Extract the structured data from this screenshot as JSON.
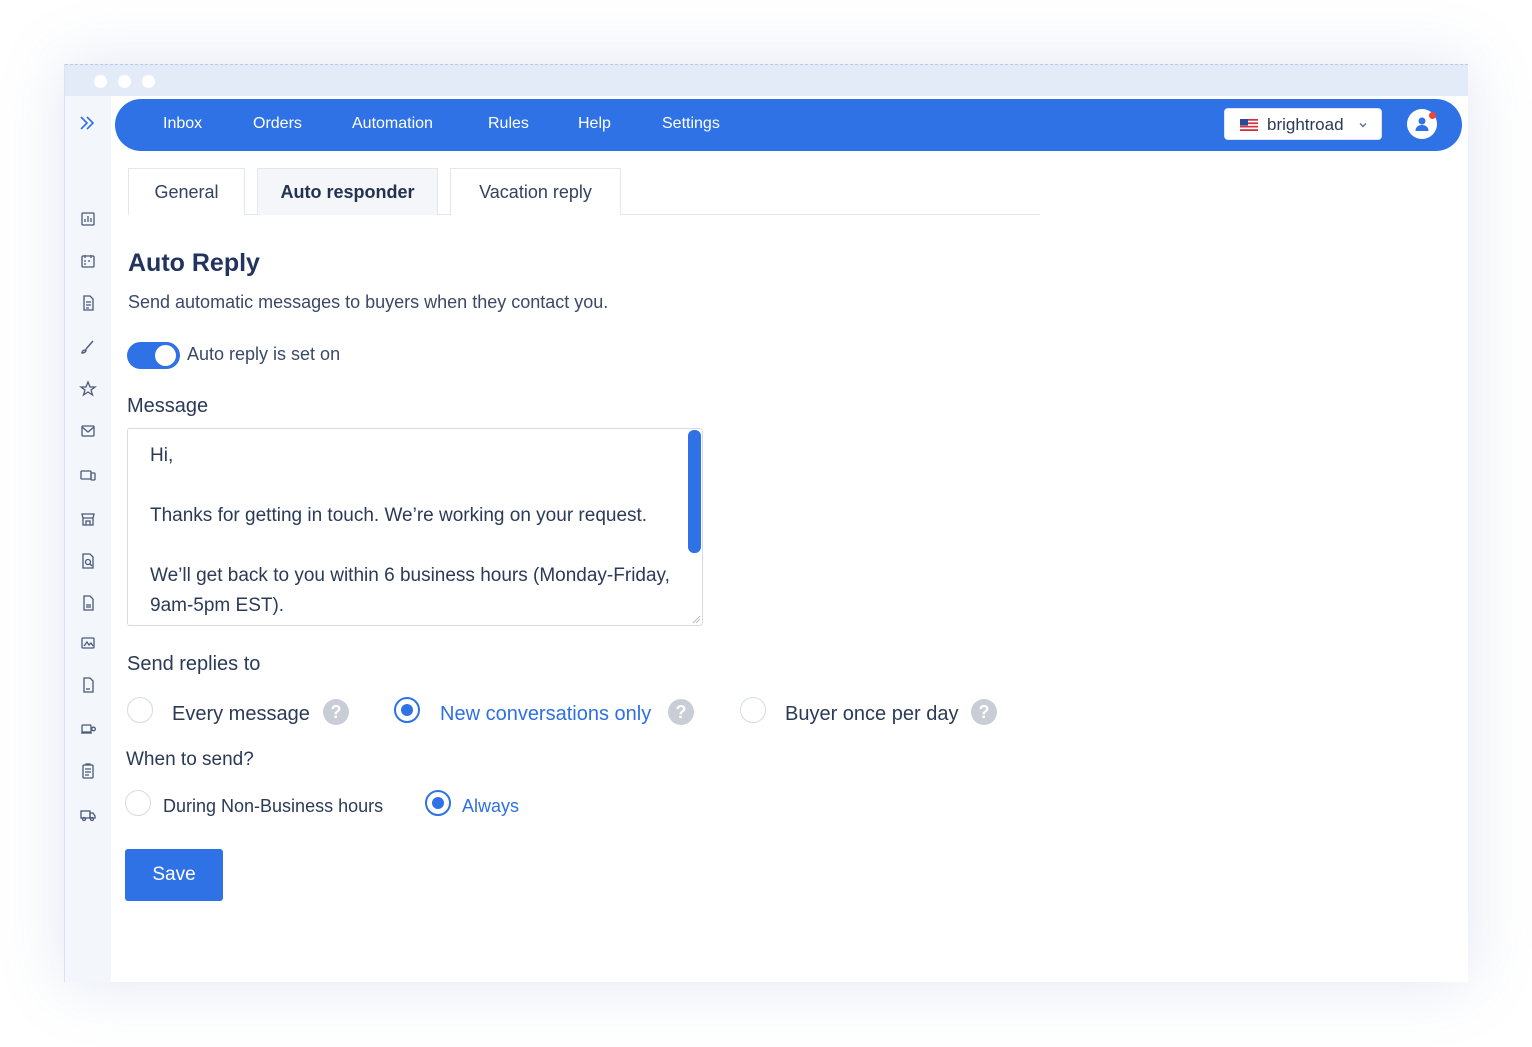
{
  "nav": {
    "items": [
      "Inbox",
      "Orders",
      "Automation",
      "Rules",
      "Help",
      "Settings"
    ],
    "account": "brightroad"
  },
  "tabs": [
    "General",
    "Auto responder",
    "Vacation reply"
  ],
  "active_tab": "Auto responder",
  "page": {
    "title": "Auto Reply",
    "subtitle": "Send automatic messages to buyers when they contact you.",
    "toggle_label": "Auto reply is set on",
    "toggle_on": true
  },
  "message": {
    "label": "Message",
    "text": "Hi,\n\nThanks for getting in touch. We’re working on your request.\n\nWe’ll get back to you within 6 business hours (Monday-Friday, 9am-5pm EST)."
  },
  "send_replies": {
    "label": "Send replies to",
    "options": [
      "Every message",
      "New conversations only",
      "Buyer once per day"
    ],
    "selected": "New conversations only",
    "help_glyph": "?"
  },
  "when_to_send": {
    "label": "When to send?",
    "options": [
      "During Non-Business hours",
      "Always"
    ],
    "selected": "Always"
  },
  "save_label": "Save",
  "colors": {
    "accent": "#2f72e6",
    "text": "#2b3a57"
  },
  "sidebar_icons": [
    "chart-icon",
    "calendar-icon",
    "document-icon",
    "brush-icon",
    "star-icon",
    "mail-icon",
    "devices-icon",
    "store-icon",
    "search-document-icon",
    "file-icon",
    "image-icon",
    "page-icon",
    "laptop-gear-icon",
    "clipboard-icon",
    "truck-icon"
  ]
}
